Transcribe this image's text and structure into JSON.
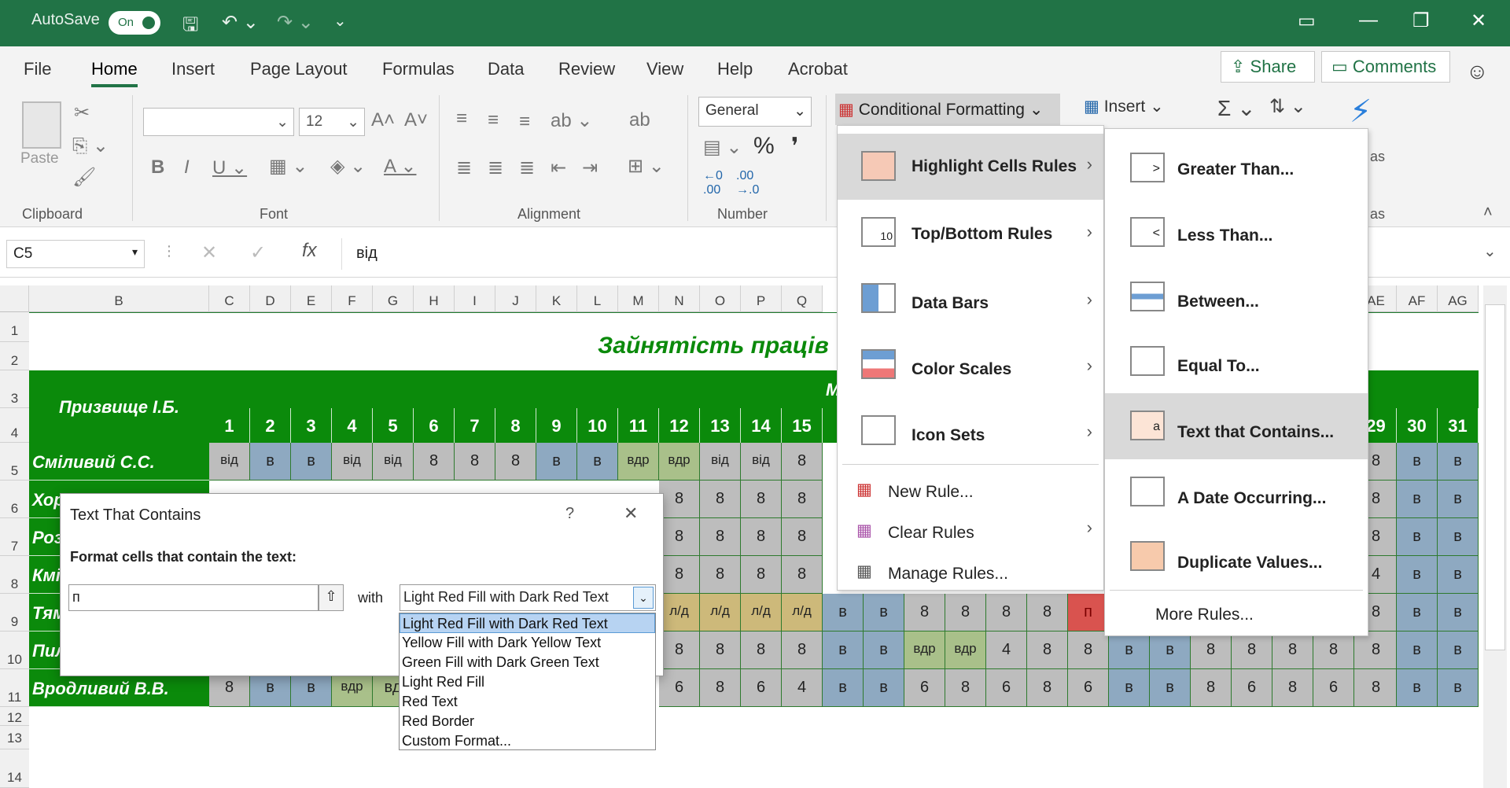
{
  "titlebar": {
    "autosave": "AutoSave",
    "toggle": "On"
  },
  "tabs": [
    "File",
    "Home",
    "Insert",
    "Page Layout",
    "Formulas",
    "Data",
    "Review",
    "View",
    "Help",
    "Acrobat"
  ],
  "share": "Share",
  "comments": "Comments",
  "ribbon": {
    "paste": "Paste",
    "clipboard": "Clipboard",
    "font": "Font",
    "font_size": "12",
    "alignment": "Alignment",
    "number_format": "General",
    "number": "Number",
    "cond_fmt": "Conditional Formatting",
    "insert": "Insert",
    "as1": "as",
    "as2": "as"
  },
  "formula": {
    "namebox": "C5",
    "value": "від"
  },
  "columns": [
    "B",
    "C",
    "D",
    "E",
    "F",
    "G",
    "H",
    "I",
    "J",
    "K",
    "L",
    "M",
    "N",
    "O",
    "P",
    "Q",
    "AE",
    "AF",
    "AG"
  ],
  "rows": [
    "1",
    "2",
    "3",
    "4",
    "5",
    "6",
    "7",
    "8",
    "9",
    "10",
    "11",
    "12",
    "13",
    "14"
  ],
  "sheet": {
    "title": "Зайнятість праців",
    "header_name": "Призвище І.Б.",
    "header_month": "М",
    "days": [
      "1",
      "2",
      "3",
      "4",
      "5",
      "6",
      "7",
      "8",
      "9",
      "10",
      "11",
      "12",
      "13",
      "14",
      "15"
    ],
    "days_right": [
      "29",
      "30",
      "31"
    ],
    "names": [
      "Сміливий С.С.",
      "Хор",
      "Роз",
      "Кмі",
      "Тям",
      "Пил",
      "Вродливий В.В."
    ],
    "row5": [
      "від",
      "в",
      "в",
      "від",
      "від",
      "8",
      "8",
      "8",
      "в",
      "в",
      "вдр",
      "вдр",
      "від",
      "від",
      "8"
    ],
    "row5r": [
      "8",
      "в",
      "в"
    ],
    "row6": [
      "8",
      "8",
      "8",
      "8"
    ],
    "row6r": [
      "8",
      "в",
      "в"
    ],
    "row7": [
      "8",
      "8",
      "8",
      "8"
    ],
    "row7r": [
      "8",
      "в",
      "в"
    ],
    "row8": [
      "8",
      "8",
      "8",
      "8"
    ],
    "row8r": [
      "4",
      "в",
      "в"
    ],
    "row9": [
      "л/д",
      "л/д",
      "л/д",
      "л/д",
      "в",
      "в",
      "8",
      "8",
      "8",
      "8",
      "п"
    ],
    "row9r": [
      "8",
      "в",
      "в"
    ],
    "row10": [
      "8",
      "8",
      "8",
      "8",
      "в",
      "в",
      "вдр",
      "вдр",
      "4",
      "8",
      "8",
      "в",
      "в",
      "8",
      "8",
      "8",
      "8",
      "8"
    ],
    "row10r": [
      "8",
      "в",
      "в"
    ],
    "row11": [
      "8",
      "в",
      "в",
      "вдр",
      "вд"
    ],
    "row11b": [
      "6",
      "8",
      "6",
      "4",
      "в",
      "в",
      "6",
      "8",
      "6",
      "8",
      "6",
      "в",
      "в",
      "8",
      "6",
      "8",
      "6",
      "8"
    ],
    "row11r": [
      "8",
      "в",
      "в"
    ]
  },
  "cf_menu": [
    "Highlight Cells Rules",
    "Top/Bottom Rules",
    "Data Bars",
    "Color Scales",
    "Icon Sets",
    "New Rule...",
    "Clear Rules",
    "Manage Rules..."
  ],
  "cf_icon_text": "10",
  "hl_menu": [
    "Greater Than...",
    "Less Than...",
    "Between...",
    "Equal To...",
    "Text that Contains...",
    "A Date Occurring...",
    "Duplicate Values...",
    "More Rules..."
  ],
  "hl_icon_text": {
    "greater": ">",
    "less": "<",
    "contains": "a"
  },
  "dialog": {
    "title": "Text That Contains",
    "help": "?",
    "prompt": "Format cells that contain the text:",
    "input": "п",
    "with": "with",
    "selected": "Light Red Fill with Dark Red Text",
    "options": [
      "Light Red Fill with Dark Red Text",
      "Yellow Fill with Dark Yellow Text",
      "Green Fill with Dark Green Text",
      "Light Red Fill",
      "Red Text",
      "Red Border",
      "Custom Format..."
    ]
  },
  "colors": {
    "excel_green": "#217346",
    "header_green": "#0b8a0b",
    "weekend": "#8ea9c1",
    "vacation": "#bdbdbd",
    "sick": "#a9c08a",
    "ld": "#cdb97a",
    "red": "#d9534f"
  }
}
